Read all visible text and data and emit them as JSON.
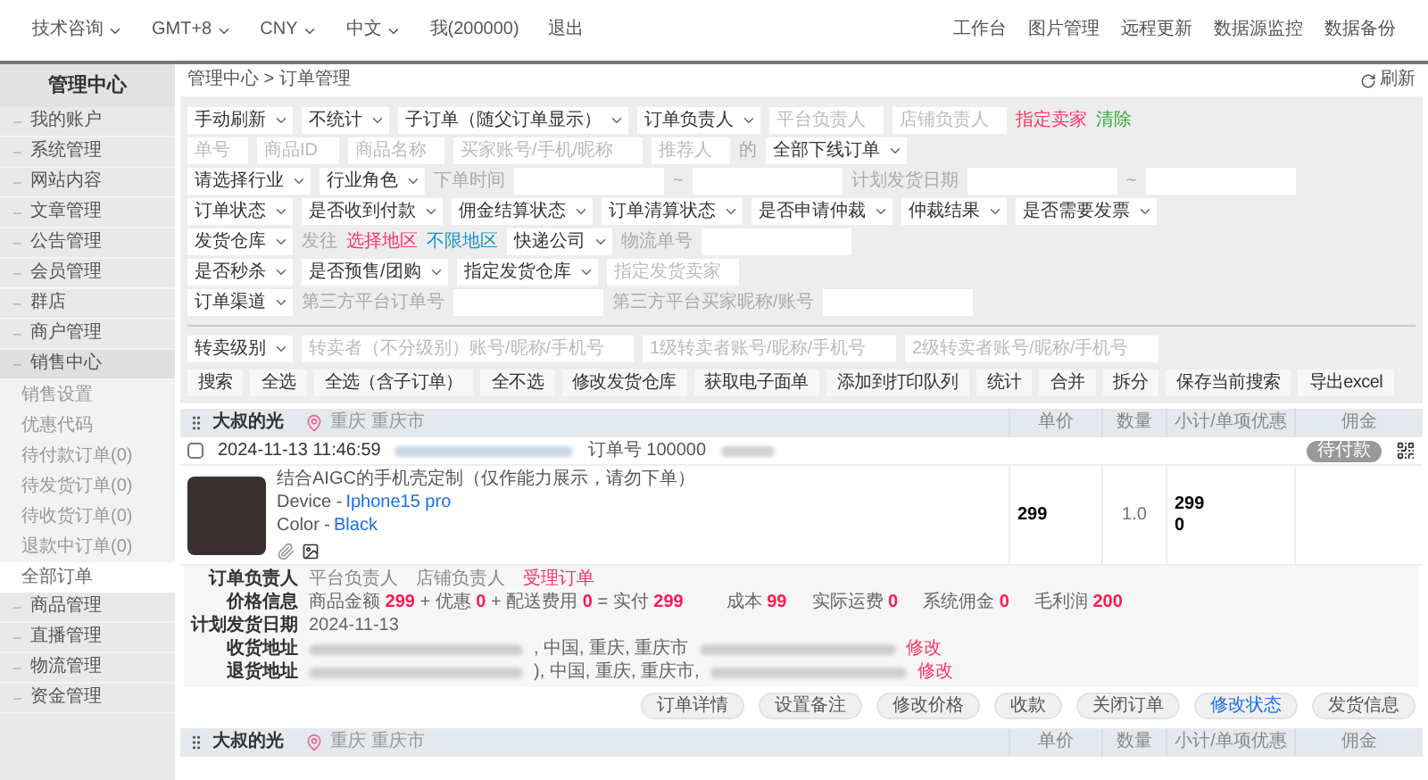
{
  "top_bar": {
    "left_menus": [
      {
        "label": "技术咨询",
        "dropdown": true
      },
      {
        "label": "GMT+8",
        "dropdown": true
      },
      {
        "label": "CNY",
        "dropdown": true
      },
      {
        "label": "中文",
        "dropdown": true
      },
      {
        "label": "我(200000)",
        "dropdown": false
      },
      {
        "label": "退出",
        "dropdown": false
      }
    ],
    "right_links": [
      "工作台",
      "图片管理",
      "远程更新",
      "数据源监控",
      "数据备份"
    ]
  },
  "sidebar": {
    "title": "管理中心",
    "items": [
      {
        "label": "我的账户"
      },
      {
        "label": "系统管理"
      },
      {
        "label": "网站内容"
      },
      {
        "label": "文章管理"
      },
      {
        "label": "公告管理"
      },
      {
        "label": "会员管理"
      },
      {
        "label": "群店"
      },
      {
        "label": "商户管理"
      },
      {
        "label": "销售中心",
        "children": [
          {
            "label": "销售设置",
            "selected": false
          },
          {
            "label": "优惠代码",
            "selected": false
          },
          {
            "label": "待付款订单(0)",
            "selected": false
          },
          {
            "label": "待发货订单(0)",
            "selected": false
          },
          {
            "label": "待收货订单(0)",
            "selected": false
          },
          {
            "label": "退款中订单(0)",
            "selected": false
          },
          {
            "label": "全部订单",
            "selected": true
          }
        ]
      },
      {
        "label": "商品管理"
      },
      {
        "label": "直播管理"
      },
      {
        "label": "物流管理"
      },
      {
        "label": "资金管理"
      }
    ]
  },
  "breadcrumb": "管理中心 > 订单管理",
  "refresh": "刷新",
  "filters": {
    "rows": [
      {
        "controls": [
          {
            "kind": "select",
            "label": "手动刷新"
          },
          {
            "kind": "select",
            "label": "不统计"
          },
          {
            "kind": "select",
            "label": "子订单（随父订单显示）"
          },
          {
            "kind": "select",
            "label": "订单负责人"
          },
          {
            "kind": "input",
            "placeholder": "平台负责人"
          },
          {
            "kind": "input",
            "placeholder": "店铺负责人"
          },
          {
            "kind": "link",
            "label": "指定卖家",
            "color": "#ff3366"
          },
          {
            "kind": "link",
            "label": "清除",
            "color": "#33aa33"
          }
        ]
      },
      {
        "controls": [
          {
            "kind": "input",
            "placeholder": "单号"
          },
          {
            "kind": "input",
            "placeholder": "商品ID"
          },
          {
            "kind": "input",
            "placeholder": "商品名称"
          },
          {
            "kind": "input",
            "placeholder": "买家账号/手机/昵称"
          },
          {
            "kind": "input",
            "placeholder": "推荐人"
          },
          {
            "kind": "text",
            "label": "的"
          },
          {
            "kind": "select",
            "label": "全部下线订单"
          }
        ]
      },
      {
        "controls": [
          {
            "kind": "select",
            "label": "请选择行业"
          },
          {
            "kind": "select",
            "label": "行业角色"
          },
          {
            "kind": "text",
            "label": "下单时间"
          },
          {
            "kind": "input"
          },
          {
            "kind": "text",
            "label": "~"
          },
          {
            "kind": "input"
          },
          {
            "kind": "text",
            "label": "计划发货日期"
          },
          {
            "kind": "input"
          },
          {
            "kind": "text",
            "label": "~"
          },
          {
            "kind": "input"
          }
        ]
      },
      {
        "controls": [
          {
            "kind": "select",
            "label": "订单状态"
          },
          {
            "kind": "select",
            "label": "是否收到付款"
          },
          {
            "kind": "select",
            "label": "佣金结算状态"
          },
          {
            "kind": "select",
            "label": "订单清算状态"
          },
          {
            "kind": "select",
            "label": "是否申请仲裁"
          },
          {
            "kind": "select",
            "label": "仲裁结果"
          },
          {
            "kind": "select",
            "label": "是否需要发票"
          }
        ]
      },
      {
        "controls": [
          {
            "kind": "select",
            "label": "发货仓库"
          },
          {
            "kind": "text",
            "label": "发往"
          },
          {
            "kind": "link",
            "label": "选择地区",
            "color": "#ff3366"
          },
          {
            "kind": "link",
            "label": "不限地区",
            "color": "#1a8fc9"
          },
          {
            "kind": "select",
            "label": "快递公司"
          },
          {
            "kind": "text",
            "label": "物流单号"
          },
          {
            "kind": "input"
          }
        ]
      },
      {
        "controls": [
          {
            "kind": "select",
            "label": "是否秒杀"
          },
          {
            "kind": "select",
            "label": "是否预售/团购"
          },
          {
            "kind": "select",
            "label": "指定发货仓库"
          },
          {
            "kind": "input",
            "placeholder": "指定发货卖家"
          }
        ]
      },
      {
        "controls": [
          {
            "kind": "select",
            "label": "订单渠道"
          },
          {
            "kind": "text",
            "label": "第三方平台订单号"
          },
          {
            "kind": "input"
          },
          {
            "kind": "text",
            "label": "第三方平台买家昵称/账号"
          },
          {
            "kind": "input"
          }
        ]
      }
    ],
    "resale_row": [
      {
        "kind": "select",
        "label": "转卖级别"
      },
      {
        "kind": "input",
        "placeholder": "转卖者（不分级别）账号/昵称/手机号"
      },
      {
        "kind": "input",
        "placeholder": "1级转卖者账号/昵称/手机号"
      },
      {
        "kind": "input",
        "placeholder": "2级转卖者账号/昵称/手机号"
      }
    ],
    "actions": [
      "搜索",
      "全选",
      "全选（含子订单）",
      "全不选",
      "修改发货仓库",
      "获取电子面单",
      "添加到打印队列",
      "统计",
      "合并",
      "拆分",
      "保存当前搜索",
      "导出excel"
    ]
  },
  "orders": [
    {
      "shop": "大叔的光",
      "location": "重庆 重庆市",
      "columns": [
        "单价",
        "数量",
        "小计/单项优惠",
        "佣金"
      ],
      "checked": false,
      "date": "2024-11-13 11:46:59",
      "order_no": "订单号 100000",
      "status": "待付款",
      "product": {
        "title": "结合AIGC的手机壳定制（仅作能力展示，请勿下单）",
        "options": [
          {
            "name": "Device - ",
            "value": "Iphone15 pro"
          },
          {
            "name": "Color - ",
            "value": "Black"
          }
        ]
      },
      "unit_price": "299",
      "quantity": "1.0",
      "subtotal": "299",
      "discount": "0",
      "details": [
        {
          "kind": "assignees",
          "label": "订单负责人",
          "items": [
            "平台负责人",
            "店铺负责人"
          ],
          "action": "受理订单"
        },
        {
          "kind": "price",
          "label": "价格信息",
          "text": "商品金额 **299** + 优惠 **0** + 配送费用 **0** = 实付 **299**",
          "extras": [
            "成本 **99**",
            "实际运费 **0**",
            "系统佣金 **0**",
            "毛利润 **200**"
          ]
        },
        {
          "kind": "plain",
          "label": "计划发货日期",
          "text": "2024-11-13"
        },
        {
          "kind": "address",
          "label": "收货地址",
          "text": ", 中国, 重庆, 重庆市",
          "action": "修改"
        },
        {
          "kind": "address",
          "label": "退货地址",
          "text": "), 中国, 重庆, 重庆市,",
          "action": "修改"
        }
      ],
      "buttons": [
        {
          "label": "订单详情",
          "selected": false
        },
        {
          "label": "设置备注",
          "selected": false
        },
        {
          "label": "修改价格",
          "selected": false
        },
        {
          "label": "收款",
          "selected": false
        },
        {
          "label": "关闭订单",
          "selected": false
        },
        {
          "label": "修改状态",
          "selected": true
        },
        {
          "label": "发货信息",
          "selected": false
        }
      ]
    },
    {
      "shop": "大叔的光",
      "location": "重庆 重庆市",
      "columns": [
        "单价",
        "数量",
        "小计/单项优惠",
        "佣金"
      ]
    }
  ]
}
